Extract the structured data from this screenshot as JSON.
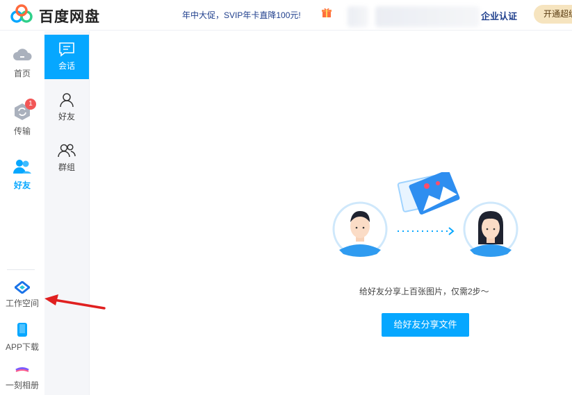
{
  "header": {
    "brand": "百度网盘",
    "promo": "年中大促，SVIP年卡直降100元!",
    "enterprise_link": "企业认证",
    "vip_button": "开通超级",
    "brand_colors": {
      "blue": "#06a7ff",
      "red": "#f25757",
      "gold": "#f6e4bf"
    }
  },
  "rail": {
    "items": [
      {
        "label": "首页",
        "icon": "cloud-icon"
      },
      {
        "label": "传输",
        "icon": "transfer-icon",
        "badge": "1"
      },
      {
        "label": "好友",
        "icon": "friends-icon",
        "active": true
      }
    ],
    "bottom_items": [
      {
        "label": "工作空间",
        "icon": "workspace-icon"
      },
      {
        "label": "APP下载",
        "icon": "phone-icon"
      },
      {
        "label": "一刻相册",
        "icon": "album-icon"
      }
    ]
  },
  "subnav": {
    "items": [
      {
        "label": "会话",
        "icon": "chat-icon",
        "active": true
      },
      {
        "label": "好友",
        "icon": "person-icon"
      },
      {
        "label": "群组",
        "icon": "group-icon"
      }
    ]
  },
  "main": {
    "empty_text": "给好友分享上百张图片，仅需2步～",
    "share_button": "给好友分享文件"
  }
}
